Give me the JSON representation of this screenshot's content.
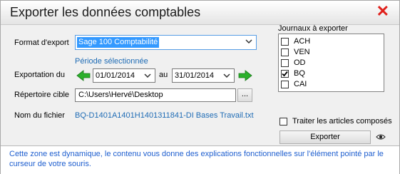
{
  "window": {
    "title": "Exporter les données comptables",
    "close_symbol": "✕"
  },
  "format": {
    "label": "Format d'export",
    "value": "Sage 100 Comptabilité"
  },
  "period": {
    "caption": "Période sélectionnée"
  },
  "exportation": {
    "label": "Exportation du",
    "from_date": "01/01/2014",
    "separator": "au",
    "to_date": "31/01/2014"
  },
  "directory": {
    "label": "Répertoire cible",
    "value": "C:\\Users\\Hervé\\Desktop",
    "browse_label": "..."
  },
  "filename": {
    "label": "Nom du fichier",
    "value": "BQ-D1401A1401H1401311841-DI Bases Travail.txt"
  },
  "journals": {
    "label": "Journaux à exporter",
    "items": [
      {
        "label": "ACH",
        "checked": false
      },
      {
        "label": "VEN",
        "checked": false
      },
      {
        "label": "OD",
        "checked": false
      },
      {
        "label": "BQ",
        "checked": true
      },
      {
        "label": "CAI",
        "checked": false
      }
    ]
  },
  "composed": {
    "label": "Traiter les articles composés",
    "checked": false
  },
  "export_button": {
    "label": "Exporter"
  },
  "info_text": "Cette zone est dynamique, le contenu vous donne des explications fonctionnelles sur l'élément pointé par le curseur de votre souris.",
  "colors": {
    "accent_blue": "#1f6cb5",
    "close_red": "#e0201b",
    "arrow_green": "#2bb02b",
    "selection": "#3399ff"
  }
}
